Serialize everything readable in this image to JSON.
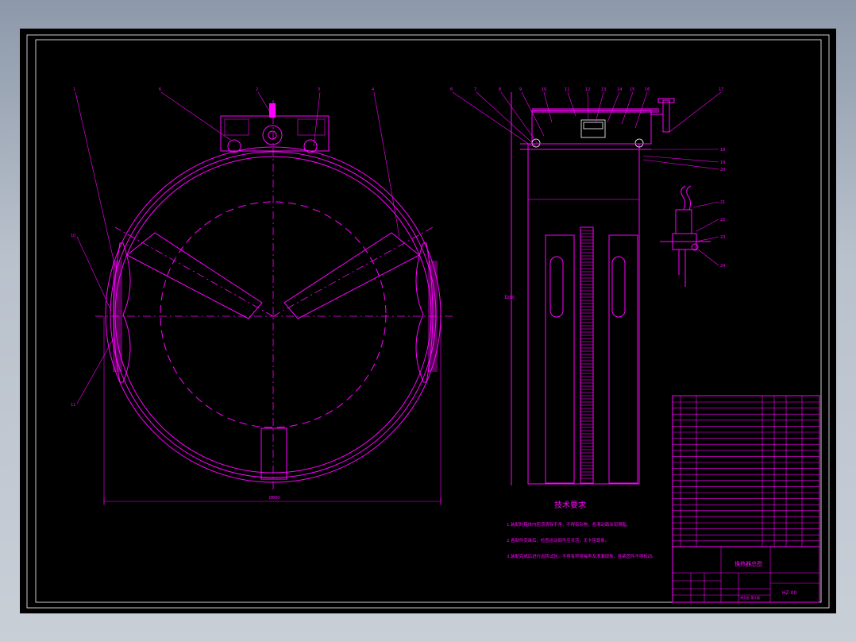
{
  "drawing": {
    "tech_title": "技术要求",
    "notes": [
      "1.装配时箱体内腔须清除干净，不得有杂物，各滑动面涂润滑脂。",
      "2.各部件安装后，检查运动部件应灵活，无卡阻现象。",
      "3.装配完成后进行运转试验，不得有异常噪声及渗漏现象，各紧固件不得松动。"
    ],
    "title_block": {
      "name": "换热器总图",
      "drawing_no": "HZ-00",
      "sheet": "共1张 第1张"
    },
    "colors": {
      "line": "#ff00ff",
      "detail": "#ffffff",
      "background": "#000000"
    }
  }
}
